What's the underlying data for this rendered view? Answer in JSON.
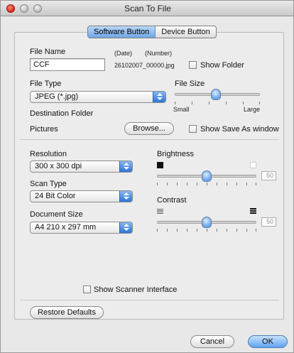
{
  "window": {
    "title": "Scan To File"
  },
  "tabs": [
    {
      "label": "Software Button",
      "active": true
    },
    {
      "label": "Device Button",
      "active": false
    }
  ],
  "file": {
    "name_label": "File Name",
    "name_value": "CCF",
    "date_label": "(Date)",
    "number_label": "(Number)",
    "example_filename": "26102007_00000.jpg",
    "show_folder_label": "Show Folder",
    "type_label": "File Type",
    "type_value": "JPEG (*.jpg)",
    "size_label": "File Size",
    "size_small": "Small",
    "size_large": "Large",
    "destination_label": "Destination Folder",
    "destination_value": "Pictures",
    "browse_label": "Browse...",
    "show_save_as_label": "Show Save As window"
  },
  "scan": {
    "resolution_label": "Resolution",
    "resolution_value": "300 x 300 dpi",
    "scan_type_label": "Scan Type",
    "scan_type_value": "24 Bit Color",
    "document_size_label": "Document Size",
    "document_size_value": "A4  210 x 297 mm",
    "brightness_label": "Brightness",
    "brightness_value": "50",
    "contrast_label": "Contrast",
    "contrast_value": "50",
    "show_scanner_interface_label": "Show Scanner Interface"
  },
  "footer": {
    "restore_defaults": "Restore Defaults",
    "cancel": "Cancel",
    "ok": "OK"
  },
  "colors": {
    "accent": "#5ea2ef",
    "close_red": "#d1271b"
  }
}
